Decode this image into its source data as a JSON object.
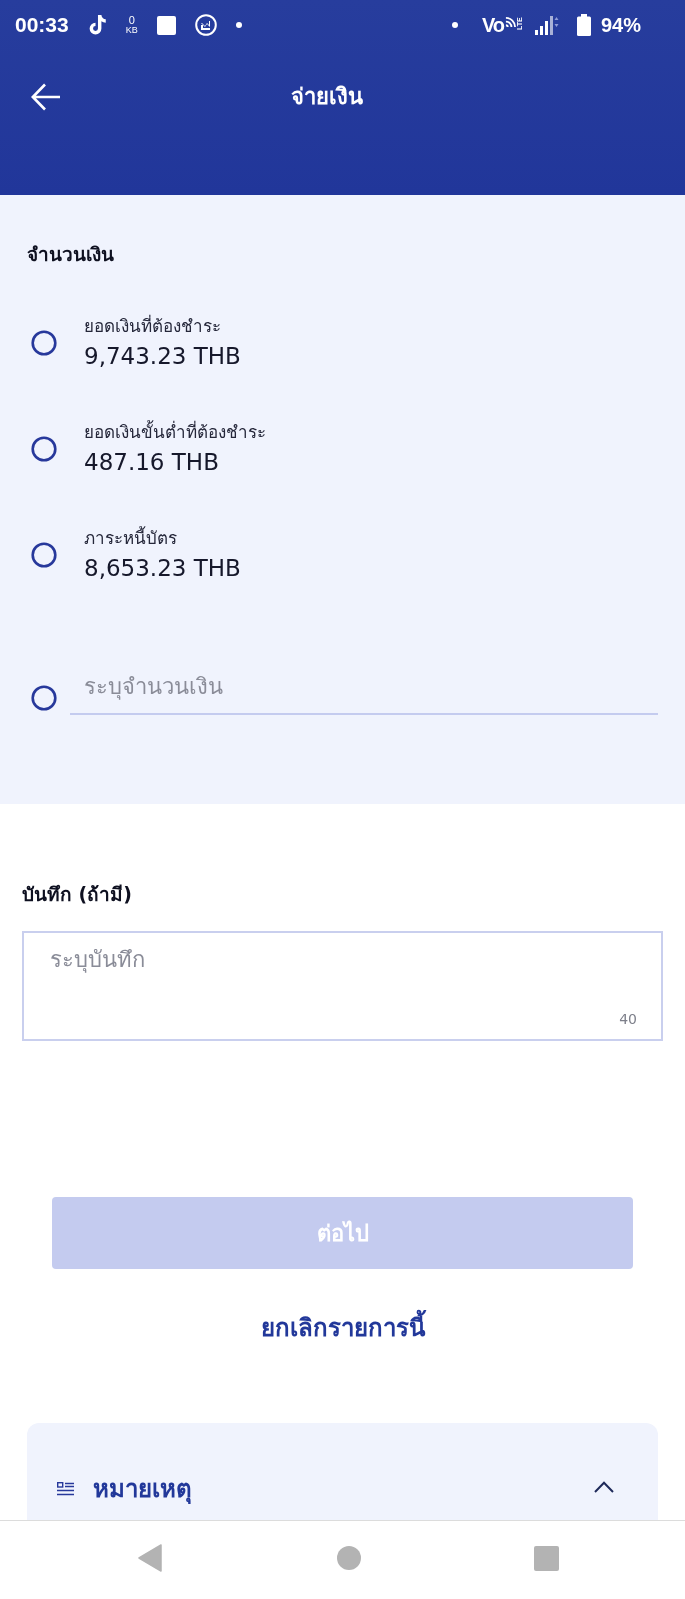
{
  "status_bar": {
    "time": "00:33",
    "data_speed_value": "0",
    "data_speed_unit": "KB",
    "call_label": "Vo",
    "network_type": "LTE",
    "battery": "94%"
  },
  "header": {
    "title": "จ่ายเงิน"
  },
  "amount_section": {
    "title": "จำนวนเงิน",
    "options": [
      {
        "kind": "preset",
        "label": "ยอดเงินที่ต้องชำระ",
        "value": "9,743.23 THB",
        "selected": false
      },
      {
        "kind": "preset",
        "label": "ยอดเงินขั้นต่ำที่ต้องชำระ",
        "value": "487.16 THB",
        "selected": false
      },
      {
        "kind": "preset",
        "label": "ภาระหนี้บัตร",
        "value": "8,653.23 THB",
        "selected": false
      },
      {
        "kind": "custom",
        "placeholder": "ระบุจำนวนเงิน",
        "selected": false
      }
    ]
  },
  "memo": {
    "label": "บันทึก (ถ้ามี)",
    "placeholder": "ระบุบันทึก",
    "char_count": "40"
  },
  "next_button": {
    "label": "ต่อไป",
    "disabled": true
  },
  "cancel_link": {
    "label": "ยกเลิกรายการนี้"
  },
  "notes": {
    "title": "หมายเหตุ",
    "expanded": true
  }
}
